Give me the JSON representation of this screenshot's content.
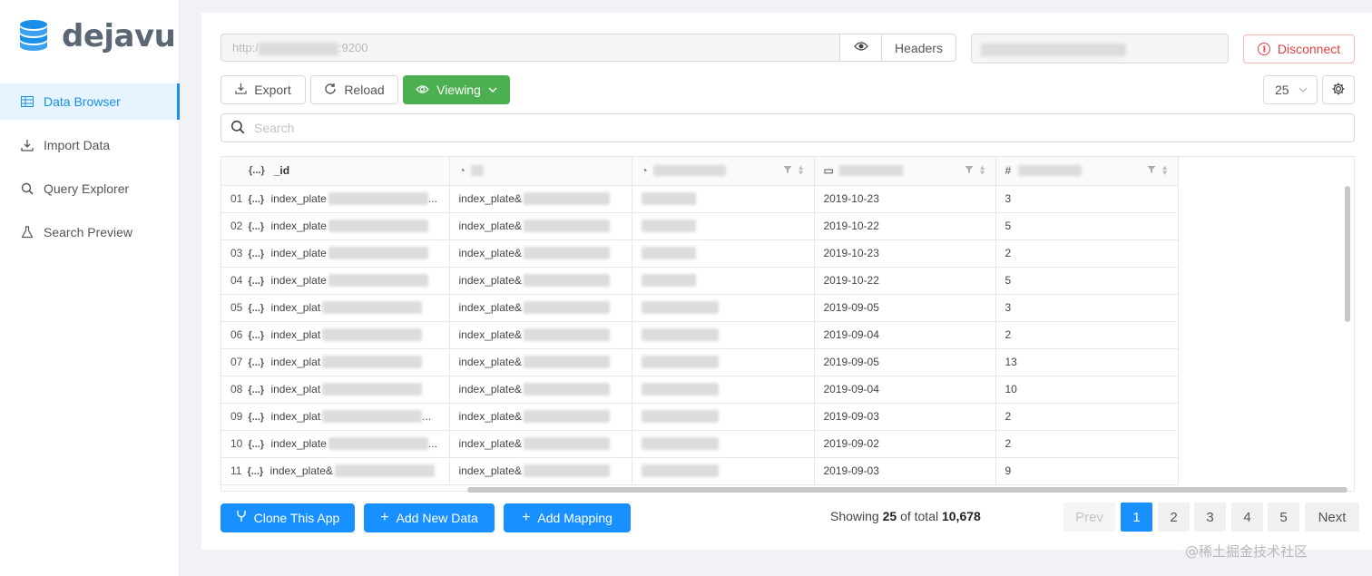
{
  "app": {
    "name": "dejavu"
  },
  "sidebar": {
    "items": [
      {
        "label": "Data Browser",
        "icon": "table-icon",
        "active": true
      },
      {
        "label": "Import Data",
        "icon": "download-icon",
        "active": false
      },
      {
        "label": "Query Explorer",
        "icon": "search-icon",
        "active": false
      },
      {
        "label": "Search Preview",
        "icon": "flask-icon",
        "active": false
      }
    ]
  },
  "connection": {
    "url_prefix": "http:/",
    "url_suffix": ":9200",
    "headers_label": "Headers",
    "disconnect_label": "Disconnect"
  },
  "toolbar": {
    "export_label": "Export",
    "reload_label": "Reload",
    "viewing_label": "Viewing",
    "page_size": "25"
  },
  "search": {
    "placeholder": "Search"
  },
  "table": {
    "columns": [
      {
        "label": "_id",
        "type_glyph": "{...}"
      },
      {
        "label": "",
        "type_glyph": "◔"
      },
      {
        "label": "",
        "type_glyph": "◔"
      },
      {
        "label": "",
        "type_glyph": "▭"
      },
      {
        "label": "",
        "type_glyph": "#"
      }
    ],
    "rows": [
      {
        "num": "01",
        "id_glyph": "{...}",
        "id": "index_plate",
        "id_tail": "...",
        "c2": "index_plate&",
        "date": "2019-10-23",
        "count": "3"
      },
      {
        "num": "02",
        "id_glyph": "{...}",
        "id": "index_plate",
        "id_tail": "",
        "c2": "index_plate&",
        "date": "2019-10-22",
        "count": "5"
      },
      {
        "num": "03",
        "id_glyph": "{...}",
        "id": "index_plate",
        "id_tail": "",
        "c2": "index_plate&",
        "date": "2019-10-23",
        "count": "2"
      },
      {
        "num": "04",
        "id_glyph": "{...}",
        "id": "index_plate",
        "id_tail": "",
        "c2": "index_plate&",
        "date": "2019-10-22",
        "count": "5"
      },
      {
        "num": "05",
        "id_glyph": "{...}",
        "id": "index_plat",
        "id_tail": "",
        "c2": "index_plate&",
        "date": "2019-09-05",
        "count": "3"
      },
      {
        "num": "06",
        "id_glyph": "{...}",
        "id": "index_plat",
        "id_tail": "",
        "c2": "index_plate&",
        "date": "2019-09-04",
        "count": "2"
      },
      {
        "num": "07",
        "id_glyph": "{...}",
        "id": "index_plat",
        "id_tail": "",
        "c2": "index_plate&",
        "date": "2019-09-05",
        "count": "13"
      },
      {
        "num": "08",
        "id_glyph": "{...}",
        "id": "index_plat",
        "id_tail": "",
        "c2": "index_plate&",
        "date": "2019-09-04",
        "count": "10"
      },
      {
        "num": "09",
        "id_glyph": "{...}",
        "id": "index_plat",
        "id_tail": "...",
        "c2": "index_plate&",
        "date": "2019-09-03",
        "count": "2"
      },
      {
        "num": "10",
        "id_glyph": "{...}",
        "id": "index_plate",
        "id_tail": "...",
        "c2": "index_plate&",
        "date": "2019-09-02",
        "count": "2"
      },
      {
        "num": "11",
        "id_glyph": "{...}",
        "id": "index_plate&",
        "id_tail": "",
        "c2": "index_plate&",
        "date": "2019-09-03",
        "count": "9"
      }
    ]
  },
  "actions": {
    "clone_label": "Clone This App",
    "add_data_label": "Add New Data",
    "add_mapping_label": "Add Mapping"
  },
  "pagination": {
    "showing_prefix": "Showing",
    "showing_count": "25",
    "showing_mid": "of total",
    "total": "10,678",
    "prev_label": "Prev",
    "pages": [
      "1",
      "2",
      "3",
      "4",
      "5"
    ],
    "next_label": "Next"
  },
  "watermark": "@稀土掘金技术社区",
  "colors": {
    "accent": "#1890ff",
    "viewing": "#4caf50",
    "danger": "#e14141",
    "sidebar_active_bg": "#e6f4ff"
  }
}
